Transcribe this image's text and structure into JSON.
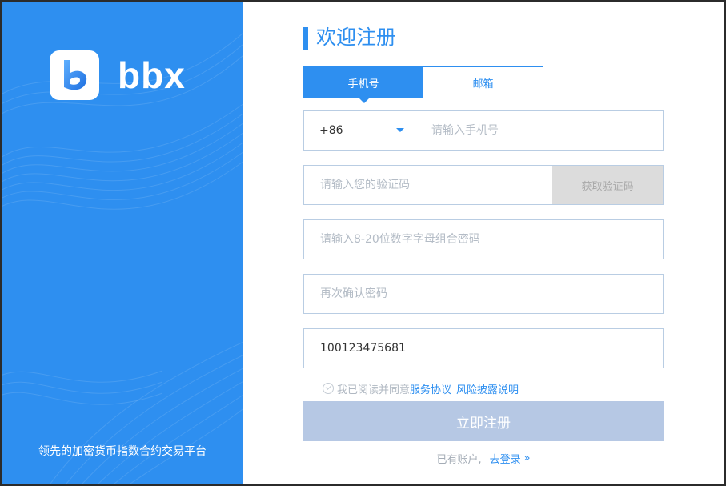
{
  "brand": {
    "name": "bbx",
    "slogan": "领先的加密货币指数合约交易平台"
  },
  "form": {
    "title": "欢迎注册",
    "tabs": [
      {
        "label": "手机号",
        "active": true
      },
      {
        "label": "邮箱",
        "active": false
      }
    ],
    "country_code": "+86",
    "phone_placeholder": "请输入手机号",
    "code_placeholder": "请输入您的验证码",
    "get_code_label": "获取验证码",
    "password_placeholder": "请输入8-20位数字字母组合密码",
    "confirm_placeholder": "再次确认密码",
    "invite_value": "100123475681",
    "agree": {
      "prefix": "我已阅读并同意",
      "service_link": "服务协议",
      "risk_link": "风险披露说明"
    },
    "submit_label": "立即注册",
    "login": {
      "prompt": "已有账户,",
      "link": "去登录"
    }
  },
  "colors": {
    "accent": "#2e8ff0",
    "submit_disabled": "#b6c8e4",
    "code_button": "#dcdcdc"
  }
}
